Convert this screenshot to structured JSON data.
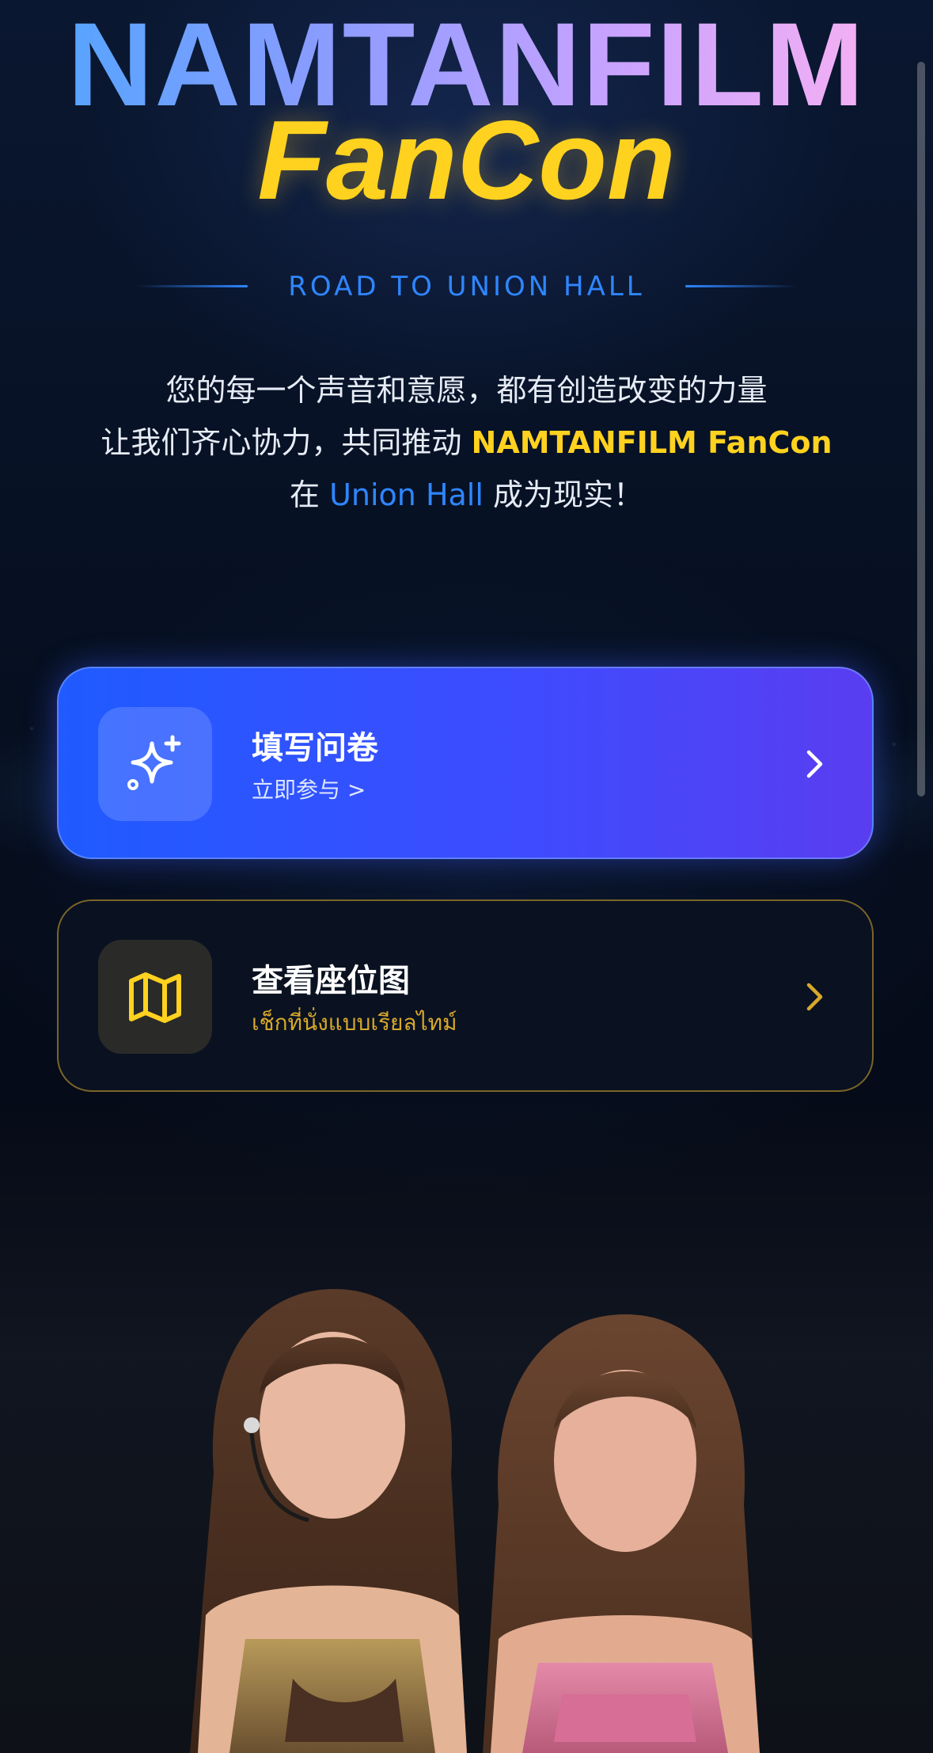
{
  "header": {
    "title_main": "NAMTANFILM",
    "title_sub": "FanCon",
    "tagline": "ROAD TO UNION HALL"
  },
  "intro": {
    "line1": "您的每一个声音和意愿，都有创造改变的力量",
    "line2_prefix": "让我们齐心协力，共同推动 ",
    "line2_highlight": "NAMTANFILM FanCon",
    "line3_prefix": "在 ",
    "line3_highlight": "Union Hall",
    "line3_suffix": " 成为现实！"
  },
  "cards": [
    {
      "title": "填写问卷",
      "subtitle": "立即参与 >",
      "icon": "sparkle-icon"
    },
    {
      "title": "查看座位图",
      "subtitle": "เช็กที่นั่งแบบเรียลไทม์",
      "icon": "map-icon"
    }
  ],
  "colors": {
    "accent_yellow": "#ffd21f",
    "accent_blue": "#2f86ff",
    "survey_gradient_start": "#1f5bff",
    "survey_gradient_end": "#5a3df0",
    "map_border": "#7a6428"
  }
}
